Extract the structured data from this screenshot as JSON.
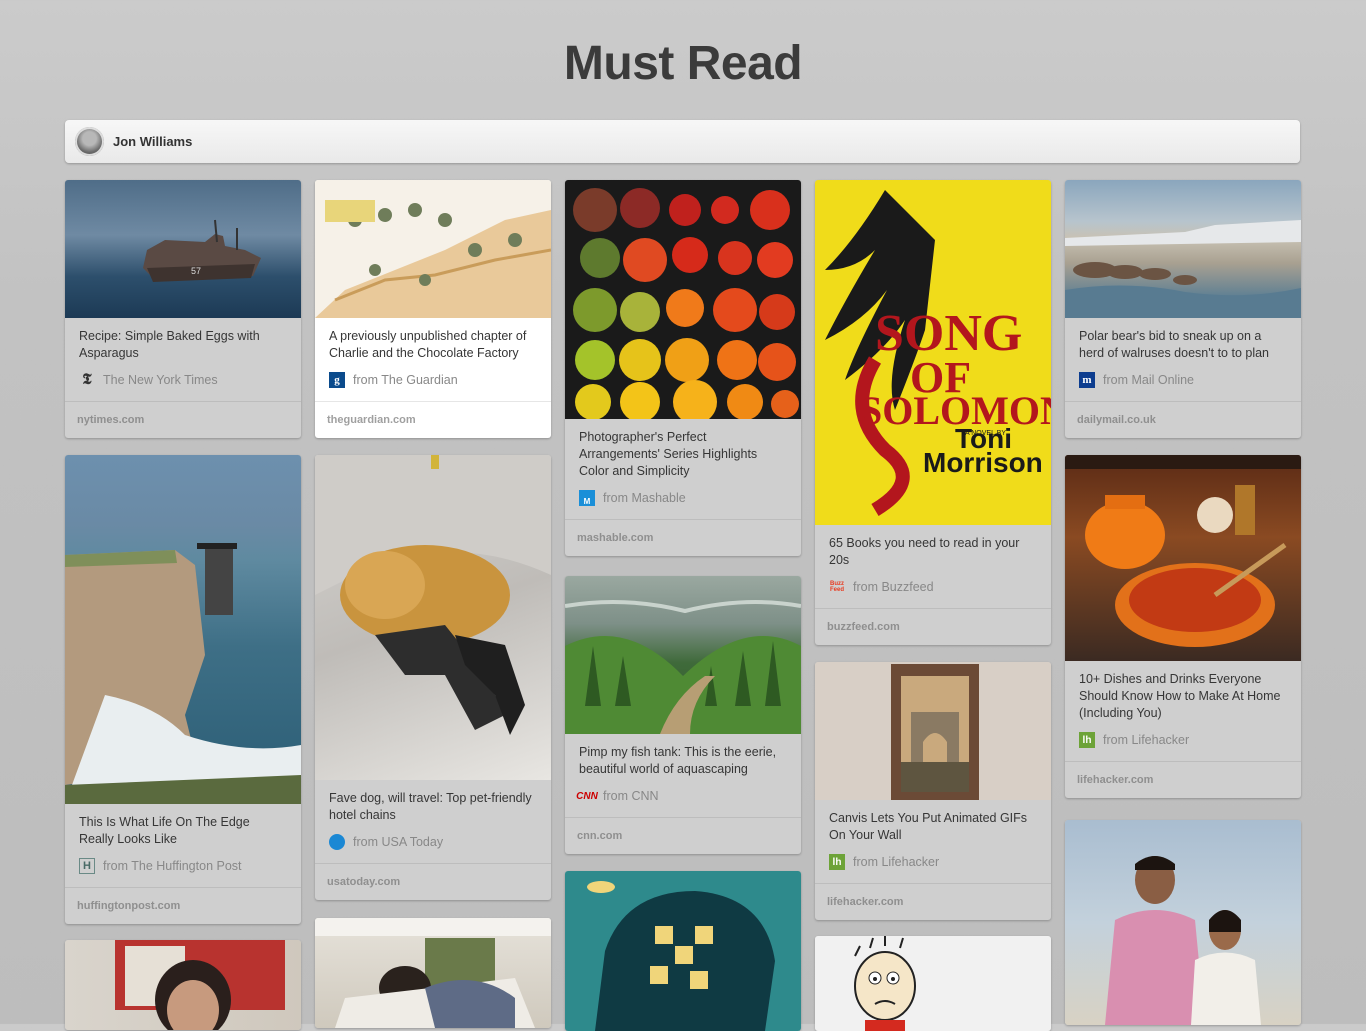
{
  "board": {
    "title": "Must Read",
    "owner": "Jon Williams"
  },
  "pins": [
    {
      "desc": "Recipe: Simple Baked Eggs with Asparagus",
      "source": "The New York Times",
      "domain": "nytimes.com",
      "icon": "nyt-icon"
    },
    {
      "desc": "A previously unpublished chapter of Charlie and the Chocolate Factory",
      "source": "from The Guardian",
      "domain": "theguardian.com",
      "icon": "guardian-icon"
    },
    {
      "desc": "Photographer's Perfect Arrangements' Series Highlights Color and Simplicity",
      "source": "from Mashable",
      "domain": "mashable.com",
      "icon": "mashable-icon"
    },
    {
      "desc": "65 Books you need to read in your 20s",
      "source": "from Buzzfeed",
      "domain": "buzzfeed.com",
      "icon": "buzzfeed-icon"
    },
    {
      "desc": "Polar bear's bid to sneak up on a herd of walruses doesn't to to plan",
      "source": "from Mail Online",
      "domain": "dailymail.co.uk",
      "icon": "mailonline-icon"
    },
    {
      "desc": "This Is What Life On The Edge Really Looks Like",
      "source": "from The Huffington Post",
      "domain": "huffingtonpost.com",
      "icon": "huffpost-icon"
    },
    {
      "desc": "Fave dog, will travel: Top pet-friendly hotel chains",
      "source": "from USA Today",
      "domain": "usatoday.com",
      "icon": "usatoday-icon"
    },
    {
      "desc": "Pimp my fish tank: This is the eerie, beautiful world of aquascaping",
      "source": "from CNN",
      "domain": "cnn.com",
      "icon": "cnn-icon"
    },
    {
      "desc": "Canvis Lets You Put Animated GIFs On Your Wall",
      "source": "from Lifehacker",
      "domain": "lifehacker.com",
      "icon": "lifehacker-icon"
    },
    {
      "desc": "10+ Dishes and Drinks Everyone Should Know How to Make At Home (Including You)",
      "source": "from Lifehacker",
      "domain": "lifehacker.com",
      "icon": "lifehacker-icon"
    }
  ],
  "book_cover": {
    "title_line1": "SONG",
    "title_line2": "OF",
    "title_line3": "SOLOMON",
    "byline": "A NOVEL BY",
    "author_first": "Toni",
    "author_last": "Morrison"
  },
  "colors": {
    "guardian": "#0b4b8c",
    "mashable": "#1a8fd8",
    "usatoday": "#1b88d4",
    "cnn": "#cc0000",
    "lifehacker": "#6da338",
    "mailonline": "#0d3d8f",
    "buzzfeed": "#e8391e"
  }
}
